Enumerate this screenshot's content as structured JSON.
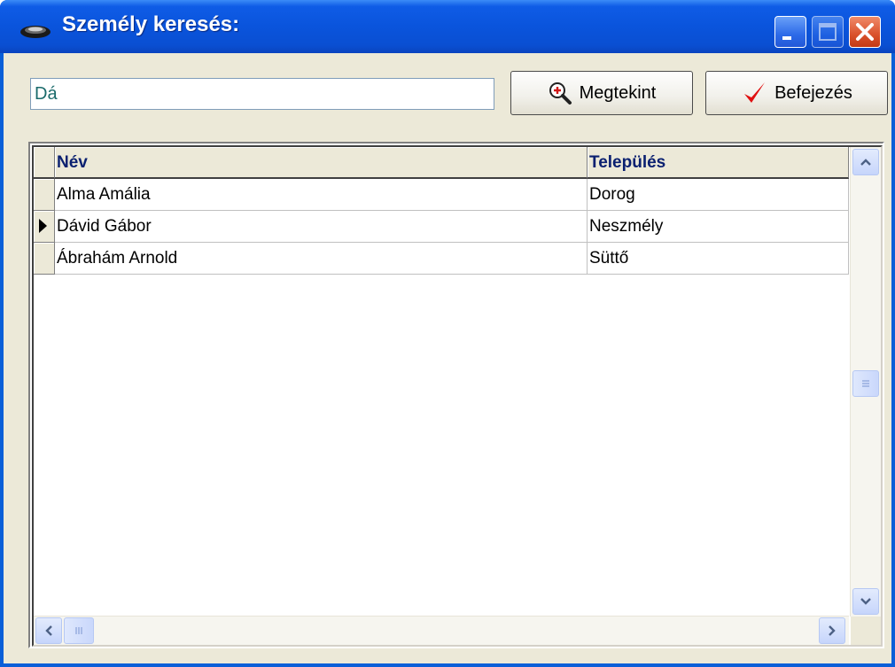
{
  "window": {
    "title": "Személy keresés:"
  },
  "toolbar": {
    "search_value": "Dá",
    "view_label": "Megtekint",
    "done_label": "Befejezés"
  },
  "grid": {
    "columns": [
      "Név",
      "Település"
    ],
    "selected_row": 1,
    "rows": [
      {
        "name": "Alma Amália",
        "town": "Dorog"
      },
      {
        "name": "Dávid Gábor",
        "town": "Neszmély"
      },
      {
        "name": "Ábrahám Arnold",
        "town": "Süttő"
      }
    ]
  },
  "icons": {
    "app": "dish-icon",
    "view": "magnifier-plus-icon",
    "done": "checkmark-icon"
  },
  "colors": {
    "titlebar": "#0a54dc",
    "header_text": "#0a2070",
    "check": "#e01010",
    "close_button": "#d9512b"
  }
}
